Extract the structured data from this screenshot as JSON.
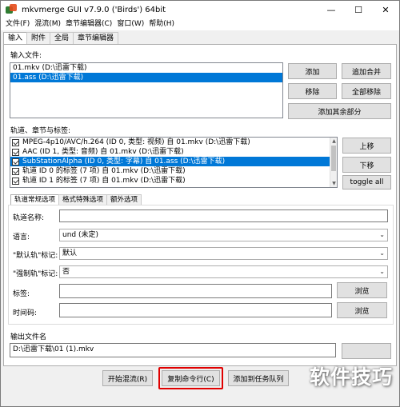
{
  "window": {
    "title": "mkvmerge GUI v7.9.0 ('Birds') 64bit",
    "controls": {
      "minimize": "—",
      "maximize": "☐",
      "close": "✕"
    }
  },
  "menu": [
    "文件(F)",
    "混流(M)",
    "章节编辑器(C)",
    "窗口(W)",
    "帮助(H)"
  ],
  "tabs": [
    "输入",
    "附件",
    "全局",
    "章节编辑器"
  ],
  "input": {
    "label": "输入文件:",
    "files": [
      "01.mkv (D:\\迅雷下载)",
      "01.ass (D:\\迅雷下载)"
    ],
    "selected_index": 1,
    "buttons": {
      "add": "添加",
      "append": "追加合并",
      "remove": "移除",
      "remove_all": "全部移除",
      "add_other": "添加其余部分"
    }
  },
  "tracks": {
    "label": "轨道、章节与标签:",
    "items": [
      "MPEG-4p10/AVC/h.264 (ID 0, 类型: 视频) 自 01.mkv (D:\\迅雷下载)",
      "AAC (ID 1, 类型: 音频) 自 01.mkv (D:\\迅雷下载)",
      "SubStationAlpha (ID 0, 类型: 字幕) 自 01.ass (D:\\迅雷下载)",
      "轨道 ID 0 的标签 (7 项) 自 01.mkv (D:\\迅雷下载)",
      "轨道 ID 1 的标签 (7 项) 自 01.mkv (D:\\迅雷下载)"
    ],
    "selected_index": 2,
    "buttons": {
      "up": "上移",
      "down": "下移",
      "toggle_all": "toggle all"
    }
  },
  "subtabs": [
    "轨道常规选项",
    "格式特殊选项",
    "额外选项"
  ],
  "options": {
    "track_name_label": "轨道名称:",
    "track_name_value": "",
    "language_label": "语言:",
    "language_value": "und (未定)",
    "default_flag_label": "\"默认轨\"标记:",
    "default_flag_value": "默认",
    "forced_flag_label": "\"强制轨\"标记:",
    "forced_flag_value": "否",
    "tags_label": "标签:",
    "tags_value": "",
    "timecodes_label": "时间码:",
    "timecodes_value": "",
    "browse": "浏览"
  },
  "output": {
    "label": "输出文件名",
    "value": "D:\\迅雷下载\\01 (1).mkv"
  },
  "actions": {
    "start": "开始混流(R)",
    "copy_cmd": "复制命令行(C)",
    "add_queue": "添加到任务队列"
  },
  "highlight_color": "#e00000",
  "accent_color": "#0078d7",
  "watermark": "软件技巧"
}
